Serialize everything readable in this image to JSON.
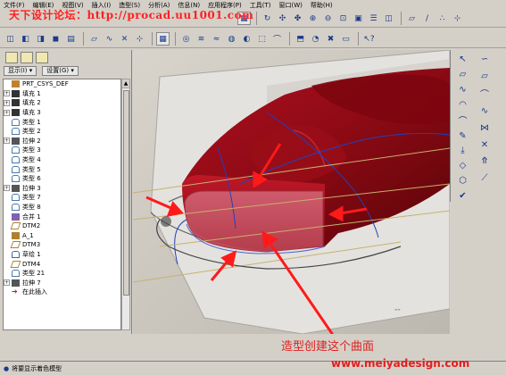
{
  "menu": [
    "文件(F)",
    "编辑(E)",
    "视图(V)",
    "插入(I)",
    "造型(S)",
    "分析(A)",
    "信息(N)",
    "应用程序(P)",
    "工具(T)",
    "窗口(W)",
    "帮助(H)"
  ],
  "watermark_top": "天下设计论坛：http://procad.uu1001.com",
  "left_panel": {
    "show_dropdown": "显示(I) ▾",
    "settings_dropdown": "设置(G) ▾",
    "tree": [
      {
        "label": "PRT_CSYS_DEF",
        "icon": "csys-icon",
        "exp": ""
      },
      {
        "label": "填充 1",
        "icon": "fill-icon",
        "exp": "+"
      },
      {
        "label": "填充 2",
        "icon": "fill-icon",
        "exp": "+"
      },
      {
        "label": "填充 3",
        "icon": "fill-icon",
        "exp": "+"
      },
      {
        "label": "类型 1",
        "icon": "style-icon",
        "exp": ""
      },
      {
        "label": "类型 2",
        "icon": "style-icon",
        "exp": ""
      },
      {
        "label": "拉伸 2",
        "icon": "extrude-icon",
        "exp": "+"
      },
      {
        "label": "类型 3",
        "icon": "style-icon",
        "exp": ""
      },
      {
        "label": "类型 4",
        "icon": "style-icon",
        "exp": ""
      },
      {
        "label": "类型 5",
        "icon": "style-icon",
        "exp": ""
      },
      {
        "label": "类型 6",
        "icon": "style-icon",
        "exp": ""
      },
      {
        "label": "拉伸 3",
        "icon": "extrude-icon",
        "exp": "+"
      },
      {
        "label": "类型 7",
        "icon": "style-icon",
        "exp": ""
      },
      {
        "label": "类型 8",
        "icon": "style-icon",
        "exp": ""
      },
      {
        "label": "合并 1",
        "icon": "merge-icon",
        "exp": ""
      },
      {
        "label": "DTM2",
        "icon": "datum-plane-icon",
        "exp": ""
      },
      {
        "label": "A_1",
        "icon": "axis-icon",
        "exp": ""
      },
      {
        "label": "DTM3",
        "icon": "datum-plane-icon",
        "exp": ""
      },
      {
        "label": "草绘 1",
        "icon": "sketch-icon",
        "exp": ""
      },
      {
        "label": "DTM4",
        "icon": "datum-plane-icon",
        "exp": ""
      },
      {
        "label": "类型 21",
        "icon": "style-icon",
        "exp": ""
      },
      {
        "label": "拉伸 7",
        "icon": "extrude-icon",
        "exp": "+"
      },
      {
        "label": "在此插入",
        "icon": "insert-here-icon",
        "exp": ""
      }
    ]
  },
  "viewport": {
    "caption": "造型创建这个曲面",
    "site": "www.meiyadesign.com"
  },
  "status": "将要显示着色模型",
  "colors": {
    "surface": "#8b0a14",
    "arrow": "#ff2020"
  }
}
